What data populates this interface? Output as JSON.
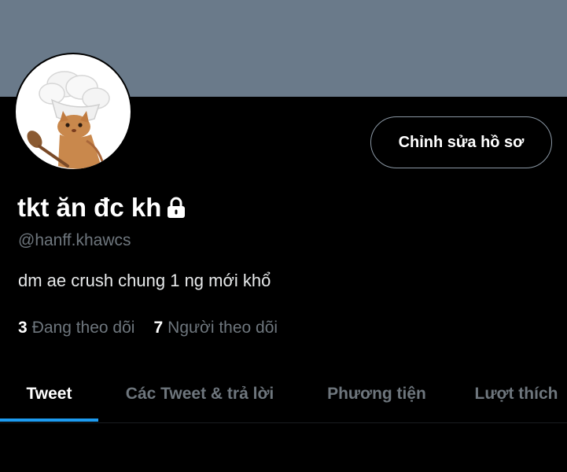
{
  "profile": {
    "display_name": "tkt ăn đc kh",
    "handle": "@hanff.khawcs",
    "bio": "dm ae crush chung 1 ng mới khổ",
    "avatar_icon": "chef-cat-icon",
    "lock_icon": "lock-icon",
    "banner_color": "#6a7a8a"
  },
  "actions": {
    "edit_profile_label": "Chỉnh sửa hồ sơ"
  },
  "stats": {
    "following_count": "3",
    "following_label": "Đang theo dõi",
    "followers_count": "7",
    "followers_label": "Người theo dõi"
  },
  "tabs": [
    {
      "label": "Tweet",
      "active": true
    },
    {
      "label": "Các Tweet & trả lời",
      "active": false
    },
    {
      "label": "Phương tiện",
      "active": false
    },
    {
      "label": "Lượt thích",
      "active": false
    }
  ],
  "colors": {
    "accent": "#1d9bf0",
    "background": "#000000",
    "muted_text": "#6e767d"
  }
}
